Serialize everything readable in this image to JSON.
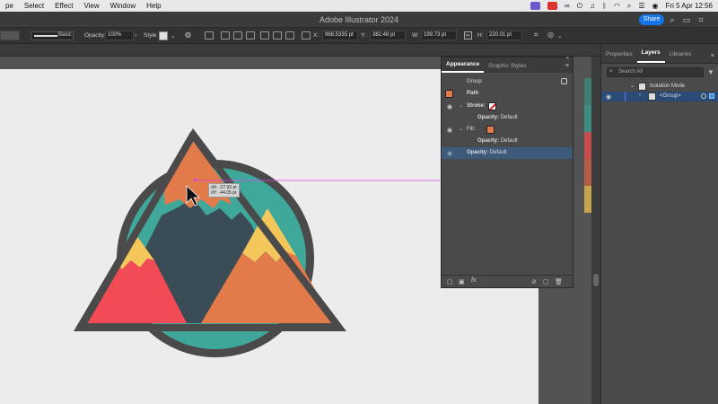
{
  "menubar": {
    "items": [
      "pe",
      "Select",
      "Effect",
      "View",
      "Window",
      "Help"
    ],
    "datetime": "Fri 5 Apr  12:56"
  },
  "titlebar": {
    "title": "Adobe Illustrator 2024",
    "share_label": "Share"
  },
  "controlbar": {
    "stroke_style": "Basic",
    "opacity_label": "Opacity:",
    "opacity_value": "100%",
    "style_label": "Style",
    "x_label": "X:",
    "x_value": "968.5335 pt",
    "y_label": "Y:",
    "y_value": "382.48 pt",
    "w_label": "W:",
    "w_value": "199.73 pt",
    "h_label": "H:",
    "h_value": "220.01 pt"
  },
  "tooltip": {
    "dx": "dX: -27.93 pt",
    "dy": "dY: -44.05 pt"
  },
  "appearance": {
    "tabs": [
      "Appearance",
      "Graphic Styles"
    ],
    "group_label": "Group",
    "path_label": "Path",
    "stroke_label": "Stroke:",
    "stroke_opacity_label": "Opacity:",
    "stroke_opacity_value": "Default",
    "fill_label": "Fill:",
    "fill_opacity_label": "Opacity:",
    "fill_opacity_value": "Default",
    "opacity_label": "Opacity:",
    "opacity_value": "Default",
    "fill_color": "#e27a4a"
  },
  "layers_panel": {
    "tabs": [
      "Properties",
      "Layers",
      "Libraries"
    ],
    "search_placeholder": "Search All",
    "isolation_label": "Isolation Mode",
    "group_label": "<Group>"
  },
  "colors": {
    "accent": "#1473e6",
    "orange": "#e27a4a",
    "teal": "#3fa89a",
    "dark": "#3a4c55",
    "yellow": "#f4c75a",
    "red": "#f24b56",
    "outline": "#4a4a4a",
    "guide": "#e040e0"
  },
  "swatch_strip": [
    "#3d7f72",
    "#3d8d80",
    "#c74a4a",
    "#b85c45",
    "#c7a449"
  ]
}
